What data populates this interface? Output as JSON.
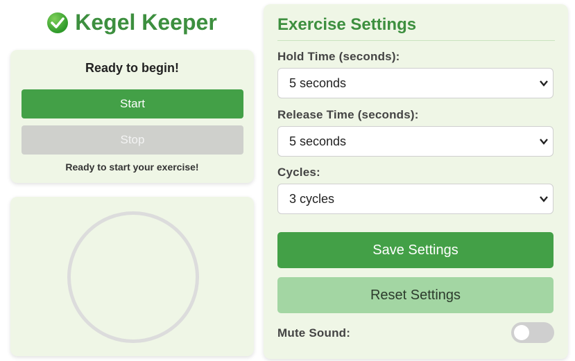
{
  "app": {
    "title": "Kegel Keeper",
    "title_icon": "check-circle-icon"
  },
  "controls": {
    "status": "Ready to begin!",
    "start_label": "Start",
    "stop_label": "Stop",
    "message": "Ready to start your exercise!"
  },
  "settings": {
    "title": "Exercise Settings",
    "hold_label": "Hold Time (seconds):",
    "hold_value": "5 seconds",
    "release_label": "Release Time (seconds):",
    "release_value": "5 seconds",
    "cycles_label": "Cycles:",
    "cycles_value": "3 cycles",
    "save_label": "Save Settings",
    "reset_label": "Reset Settings",
    "mute_label": "Mute Sound:",
    "mute_on": false
  },
  "colors": {
    "accent": "#43a047",
    "title": "#3d8f3f",
    "card_bg": "#eff6e6",
    "reset_bg": "#a3d6a3"
  }
}
